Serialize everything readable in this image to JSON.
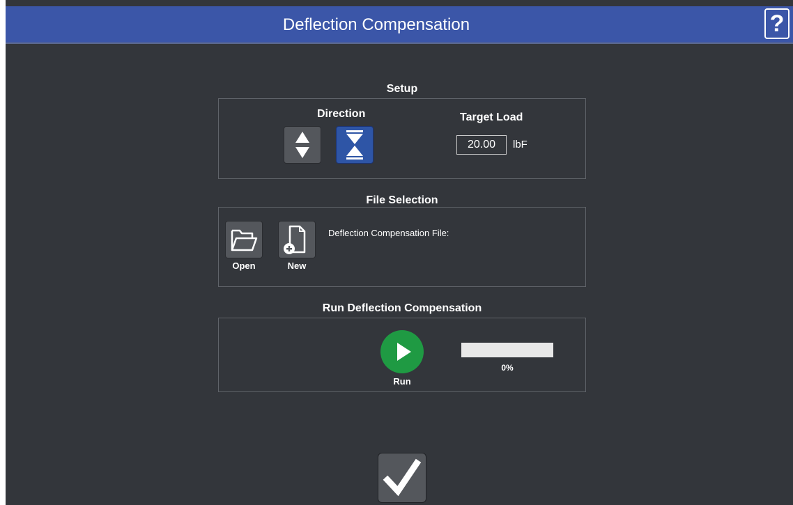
{
  "header": {
    "title": "Deflection Compensation",
    "help_label": "?"
  },
  "setup": {
    "title": "Setup",
    "direction_label": "Direction",
    "target_load_label": "Target Load",
    "target_load_value": "20.00",
    "target_load_unit": "lbF",
    "direction_buttons": [
      {
        "icon": "up-down-arrows-icon",
        "selected": false
      },
      {
        "icon": "compression-arrows-icon",
        "selected": true
      }
    ]
  },
  "file_selection": {
    "title": "File Selection",
    "open_label": "Open",
    "new_label": "New",
    "file_label": "Deflection Compensation File:"
  },
  "run": {
    "title": "Run Deflection Compensation",
    "run_label": "Run",
    "progress": 0,
    "progress_text": "0%"
  },
  "colors": {
    "header": "#3b56a8",
    "background": "#33363b",
    "selected_button": "#2e55a6",
    "run_button": "#1f9a43"
  }
}
